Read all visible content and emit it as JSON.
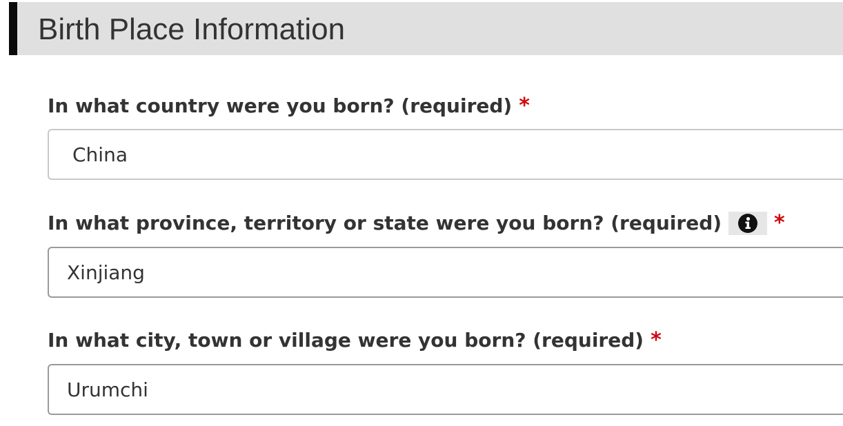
{
  "section": {
    "title": "Birth Place Information"
  },
  "fields": {
    "country": {
      "label": "In what country were you born? (required)",
      "required_mark": "*",
      "value": "China"
    },
    "province": {
      "label": "In what province, territory or state were you born? (required)",
      "required_mark": "*",
      "info_icon": "info-circle-icon",
      "value": "Xinjiang"
    },
    "city": {
      "label": "In what city, town or village were you born? (required)",
      "required_mark": "*",
      "value": "Urumchi"
    }
  },
  "colors": {
    "header_bg": "#e0e0e0",
    "header_bar": "#0a0a0a",
    "required": "#d3080c",
    "text": "#333333"
  }
}
